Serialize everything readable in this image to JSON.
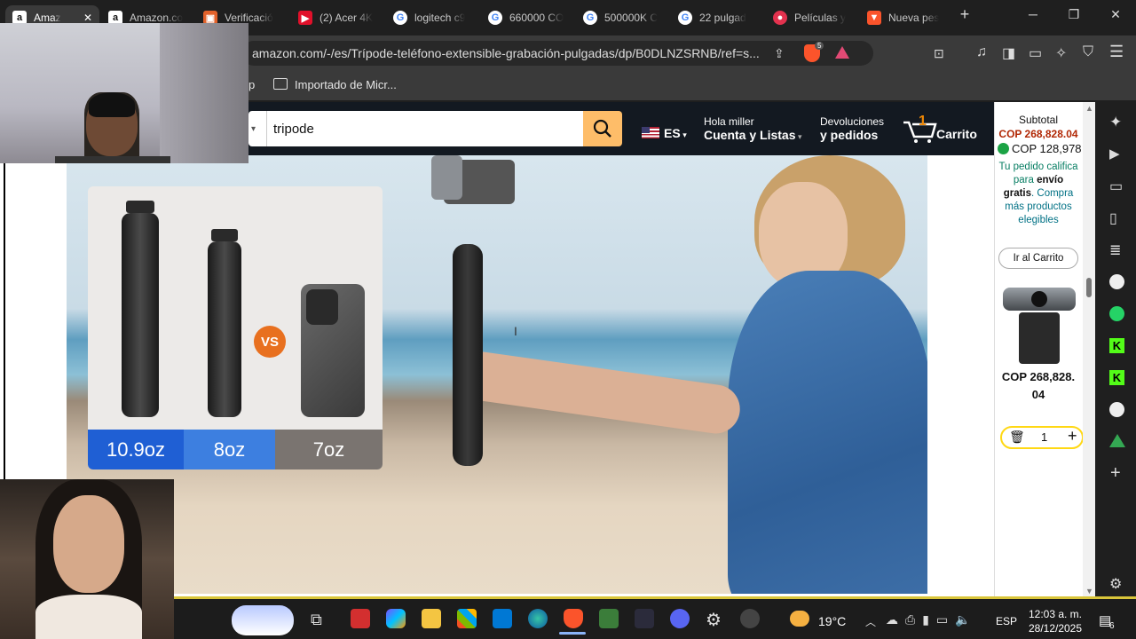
{
  "tabs": [
    {
      "label": "Amaz",
      "favicon": "amazon-icon",
      "active": true
    },
    {
      "label": "Amazon.co",
      "favicon": "amazon-icon"
    },
    {
      "label": "Verificació",
      "favicon": "shield-icon"
    },
    {
      "label": "(2) Acer 4K",
      "favicon": "youtube-icon"
    },
    {
      "label": "logitech c9",
      "favicon": "google-icon"
    },
    {
      "label": "660000 CO",
      "favicon": "google-icon"
    },
    {
      "label": "500000K C",
      "favicon": "google-icon"
    },
    {
      "label": "22 pulgad",
      "favicon": "google-icon"
    },
    {
      "label": "Películas y",
      "favicon": "film-icon"
    },
    {
      "label": "Nueva pes",
      "favicon": "brave-icon"
    }
  ],
  "address": {
    "url": "amazon.com/-/es/Trípode-teléfono-extensible-grabación-pulgadas/dp/B0DLNZSRNB/ref=s...",
    "badge": "5"
  },
  "bookmarks": {
    "partial": "p",
    "folder": "Importado de Micr..."
  },
  "amazon": {
    "search_value": "tripode",
    "lang": "ES",
    "account_line1": "Hola miller",
    "account_line2": "Cuenta y Listas",
    "returns_line1": "Devoluciones",
    "returns_line2": "y pedidos",
    "cart_count": "1",
    "cart_label": "Carrito"
  },
  "product_compare": {
    "weights": [
      "10.9oz",
      "8oz",
      "7oz"
    ],
    "vs": "VS"
  },
  "cart_panel": {
    "subtotal_label": "Subtotal",
    "subtotal_value": "COP 268,828.04",
    "alt_value": "COP 128,978",
    "shipping_text1": "Tu pedido califica para",
    "shipping_bold": "envío gratis",
    "shipping_text2": ". Compra más productos elegibles",
    "go_to_cart": "Ir al Carrito",
    "item_price": "COP 268,828. 04",
    "qty": "1"
  },
  "taskbar": {
    "temp": "19°C",
    "lang": "ESP",
    "time": "12:03 a. m.",
    "date": "28/12/2025",
    "notif": "6"
  },
  "colors": {
    "amazon_dark": "#131921",
    "amazon_orange": "#febd69",
    "price_red": "#b12704",
    "link_teal": "#007185"
  }
}
